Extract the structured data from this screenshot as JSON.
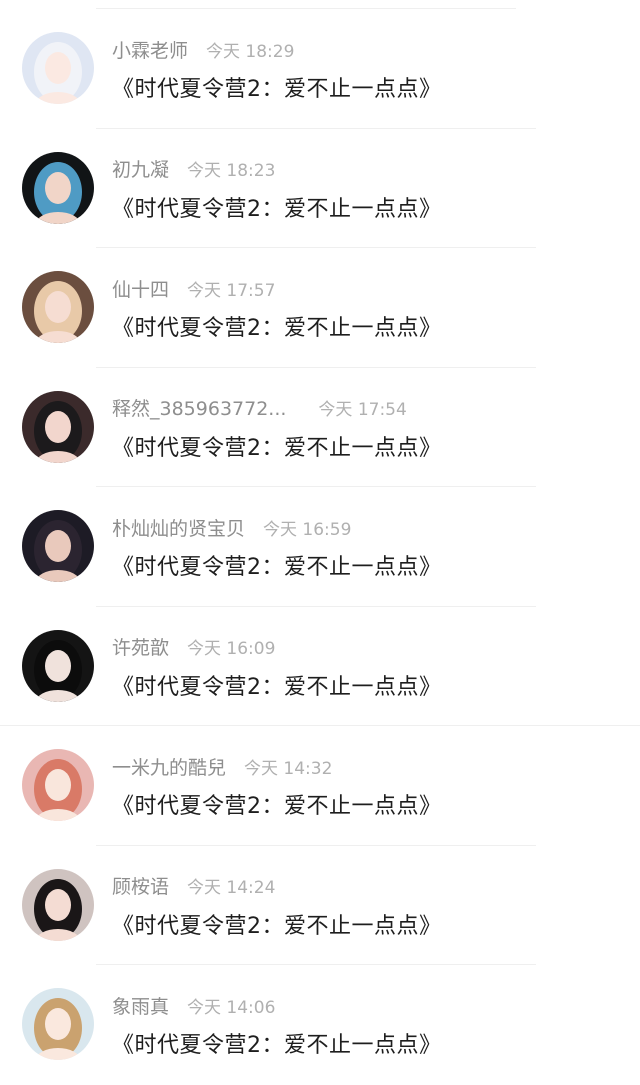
{
  "comments": [
    {
      "username": "小霖老师",
      "time": "今天 18:29",
      "message": "《时代夏令营2：爱不止一点点》",
      "avatar": {
        "bg": "#dfe6f3",
        "hair": "#f1f3f8",
        "skin": "#fbe9e2"
      }
    },
    {
      "username": "初九凝",
      "time": "今天 18:23",
      "message": "《时代夏令营2：爱不止一点点》",
      "avatar": {
        "bg": "#111416",
        "hair": "#4f9bc4",
        "skin": "#f1d5c8"
      }
    },
    {
      "username": "仙十四",
      "time": "今天 17:57",
      "message": "《时代夏令营2：爱不止一点点》",
      "avatar": {
        "bg": "#6b4e3f",
        "hair": "#e8c9a8",
        "skin": "#f6ddd2"
      }
    },
    {
      "username": "释然_385963772...",
      "time": "今天 17:54",
      "message": "《时代夏令营2：爱不止一点点》",
      "avatar": {
        "bg": "#3b2a2b",
        "hair": "#1c1a1c",
        "skin": "#f2d6cd"
      }
    },
    {
      "username": "朴灿灿的贤宝贝",
      "time": "今天 16:59",
      "message": "《时代夏令营2：爱不止一点点》",
      "avatar": {
        "bg": "#1d1b25",
        "hair": "#2b2430",
        "skin": "#e9c9bc"
      }
    },
    {
      "username": "许苑歆",
      "time": "今天 16:09",
      "message": "《时代夏令营2：爱不止一点点》",
      "avatar": {
        "bg": "#141414",
        "hair": "#0c0c0c",
        "skin": "#f0e2dc"
      }
    },
    {
      "username": "一米九的酷兒",
      "time": "今天 14:32",
      "message": "《时代夏令营2：爱不止一点点》",
      "avatar": {
        "bg": "#e9b7b3",
        "hair": "#d97a67",
        "skin": "#f9e6dc"
      }
    },
    {
      "username": "顾桉语",
      "time": "今天 14:24",
      "message": "《时代夏令营2：爱不止一点点》",
      "avatar": {
        "bg": "#cfc3c0",
        "hair": "#1a1617",
        "skin": "#f4dcd3"
      }
    },
    {
      "username": "象雨真",
      "time": "今天 14:06",
      "message": "《时代夏令营2：爱不止一点点》",
      "avatar": {
        "bg": "#d9e7ee",
        "hair": "#caa26f",
        "skin": "#fae8de"
      }
    }
  ]
}
